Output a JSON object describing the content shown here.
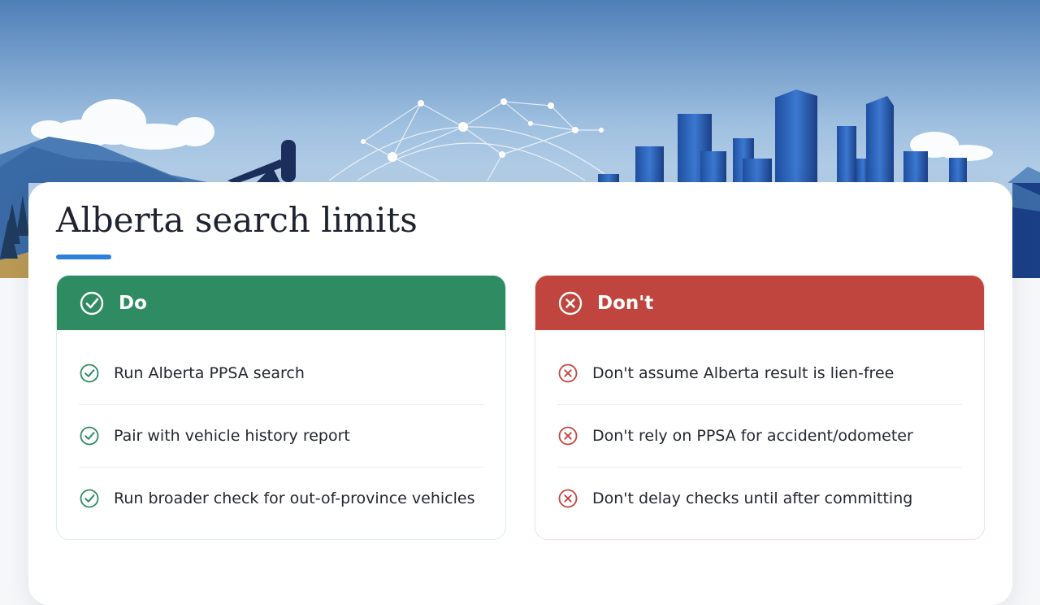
{
  "page": {
    "title": "Alberta search limits"
  },
  "colors": {
    "accent": "#2f7fdd",
    "do_header": "#2e8b62",
    "dont_header": "#c1453f",
    "do_icon": "#2e8b62",
    "dont_icon": "#c1453f"
  },
  "do_panel": {
    "header_label": "Do",
    "header_icon": "check-circle-icon",
    "items": [
      {
        "text": "Run Alberta PPSA search",
        "icon": "check-circle-icon"
      },
      {
        "text": "Pair with vehicle history report",
        "icon": "check-circle-icon"
      },
      {
        "text": "Run broader check for out-of-province vehicles",
        "icon": "check-circle-icon"
      }
    ]
  },
  "dont_panel": {
    "header_label": "Don't",
    "header_icon": "x-circle-icon",
    "items": [
      {
        "text": "Don't assume Alberta result is lien-free",
        "icon": "x-circle-icon"
      },
      {
        "text": "Don't rely on PPSA for accident/odometer",
        "icon": "x-circle-icon"
      },
      {
        "text": "Don't delay checks until after committing",
        "icon": "x-circle-icon"
      }
    ]
  }
}
